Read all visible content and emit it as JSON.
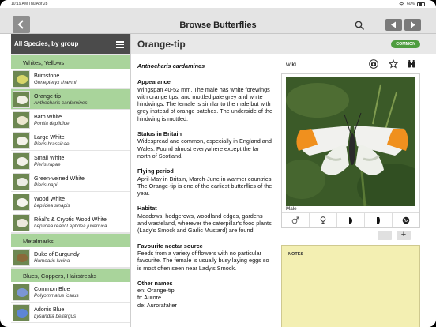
{
  "status_bar": {
    "time": "10:19 AM",
    "date": "Thu Apr 28",
    "battery": "60%",
    "battery_level": 0.6
  },
  "nav": {
    "title": "Browse Butterflies",
    "back_icon": "chevron-left-icon",
    "search_icon": "search-icon",
    "prev_icon": "triangle-left-icon",
    "next_icon": "triangle-right-icon"
  },
  "sidebar": {
    "header": "All Species, by group",
    "groups": [
      {
        "label": "Whites, Yellows",
        "items": [
          {
            "name": "Brimstone",
            "latin": "Gonepteryx rhamni",
            "selected": false
          },
          {
            "name": "Orange-tip",
            "latin": "Anthocharis cardamines",
            "selected": true
          },
          {
            "name": "Bath White",
            "latin": "Pontia daplidice",
            "selected": false
          },
          {
            "name": "Large White",
            "latin": "Pieris brassicae",
            "selected": false
          },
          {
            "name": "Small White",
            "latin": "Pieris rapae",
            "selected": false
          },
          {
            "name": "Green-veined White",
            "latin": "Pieris napi",
            "selected": false
          },
          {
            "name": "Wood White",
            "latin": "Leptidea sinapis",
            "selected": false
          },
          {
            "name": "Réal's & Cryptic Wood White",
            "latin": "Leptidea reali/ Leptidea juvernica",
            "selected": false
          }
        ]
      },
      {
        "label": "Metalmarks",
        "items": [
          {
            "name": "Duke of Burgundy",
            "latin": "Hamearis lucina",
            "selected": false
          }
        ]
      },
      {
        "label": "Blues, Coppers, Hairstreaks",
        "items": [
          {
            "name": "Common Blue",
            "latin": "Polyommatus icarus",
            "selected": false
          },
          {
            "name": "Adonis Blue",
            "latin": "Lysandra bellargus",
            "selected": false
          }
        ]
      }
    ]
  },
  "species": {
    "title": "Orange-tip",
    "badge": "COMMON",
    "latin": "Anthocharis cardamines",
    "sections": [
      {
        "title": "Appearance",
        "body": "Wingspan 40-52 mm. The male has white forewings with orange tips, and mottled pale grey and white hindwings. The female is similar to the male but with grey instead of orange patches. The underside of the hindwing is mottled."
      },
      {
        "title": "Status in Britain",
        "body": "Widespread and common, especially in England and Wales. Found almost everywhere except the far north of Scotland."
      },
      {
        "title": "Flying period",
        "body": "April-May in Britain, March-June in warmer countries. The Orange-tip is one of the earliest butterflies of the year."
      },
      {
        "title": "Habitat",
        "body": "Meadows, hedgerows, woodland edges, gardens and wasteland, wherever the caterpillar's food plants (Lady's Smock and Garlic Mustard) are found."
      },
      {
        "title": "Favourite nectar source",
        "body": "Feeds from a variety of flowers with no particular favourite. The female is usually busy laying eggs so is most often seen near Lady's Smock."
      },
      {
        "title": "Other names",
        "body": "en: Orange-tip\nfr:  Aurore\nde: Aurorafalter"
      }
    ]
  },
  "media": {
    "label": "wiki",
    "caption": "Male",
    "top_icons": [
      "camera-icon",
      "star-icon",
      "binoculars-icon"
    ],
    "photo_buttons": [
      "male-icon",
      "female-icon",
      "caterpillar-icon",
      "egg-icon",
      "globe-icon"
    ],
    "notes_label": "NOTES",
    "add_label": "+"
  },
  "colors": {
    "green": "#a9d49b",
    "badge_green": "#4e9d3f",
    "notes_yellow": "#f3efb2",
    "sidebar_header": "#4b4b4b"
  }
}
